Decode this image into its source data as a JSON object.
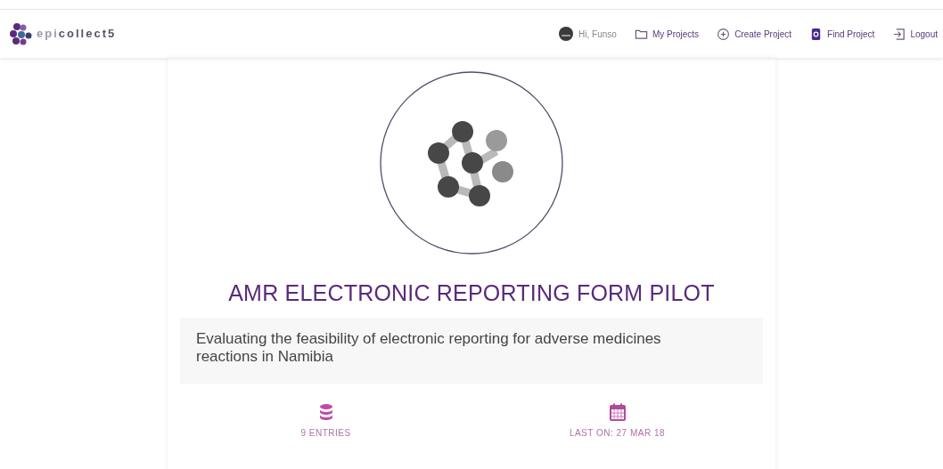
{
  "navbar": {
    "brand": "epi**collect5**",
    "user": "Hi, Funso",
    "links": [
      {
        "label": "My Projects",
        "kind": "folder"
      },
      {
        "label": "Create Project",
        "kind": "create"
      },
      {
        "label": "Find Project",
        "kind": "find"
      },
      {
        "label": "Logout",
        "kind": "logout"
      }
    ]
  },
  "project": {
    "title": "AMR ELECTRONIC REPORTING FORM PILOT",
    "description": "Evaluating the feasibility of electronic reporting for adverse medicines reactions in Namibia",
    "stats": [
      {
        "kind": "entries",
        "label": "9 ENTRIES"
      },
      {
        "kind": "date",
        "label": "LAST ON: 27 MAR 18"
      }
    ]
  }
}
